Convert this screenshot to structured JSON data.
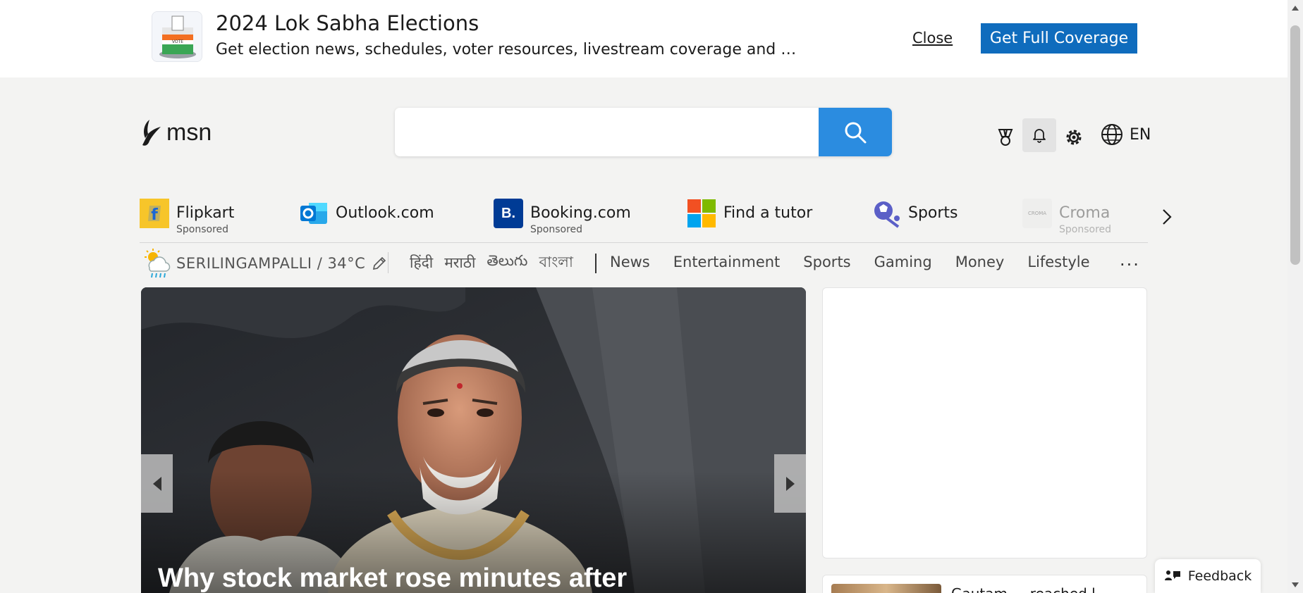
{
  "banner": {
    "title": "2024 Lok Sabha Elections",
    "subtitle": "Get election news, schedules, voter resources, livestream coverage and …",
    "close_label": "Close",
    "cta_label": "Get Full Coverage",
    "thumb_icon": "ballot-box-icon",
    "ballot_text": "VOTE"
  },
  "header": {
    "logo_text": "msn",
    "search": {
      "placeholder": "",
      "button_icon": "search-icon"
    },
    "icons": [
      "rewards-icon",
      "bell-icon",
      "gear-icon",
      "globe-icon"
    ],
    "language": "EN"
  },
  "quick_links": [
    {
      "name": "Flipkart",
      "sponsored": "Sponsored",
      "icon": "flipkart-logo"
    },
    {
      "name": "Outlook.com",
      "sponsored": "",
      "icon": "outlook-logo"
    },
    {
      "name": "Booking.com",
      "sponsored": "Sponsored",
      "icon": "booking-logo",
      "logo_letter": "B."
    },
    {
      "name": "Find a tutor",
      "sponsored": "",
      "icon": "microsoft-logo"
    },
    {
      "name": "Sports",
      "sponsored": "",
      "icon": "sports-icon"
    },
    {
      "name": "Croma",
      "sponsored": "Sponsored",
      "icon": "croma-logo",
      "logo_letter": "CROMA"
    }
  ],
  "weather": {
    "location": "SERILINGAMPALLI / 34°C",
    "icon": "partly-sunny-rain-icon"
  },
  "languages": [
    "हिंदी",
    "मराठी",
    "తెలుగు",
    "বাংলা"
  ],
  "nav": [
    "News",
    "Entertainment",
    "Sports",
    "Gaming",
    "Money",
    "Lifestyle"
  ],
  "nav_more": "···",
  "hero": {
    "title": "Why stock market rose minutes after"
  },
  "side": {
    "sub_card_text": "Gautam ... reached l..."
  },
  "feedback": {
    "label": "Feedback"
  },
  "colors": {
    "cta": "#0f6cbd",
    "search_button": "#2b8ce0",
    "background": "#f3f3f2"
  }
}
